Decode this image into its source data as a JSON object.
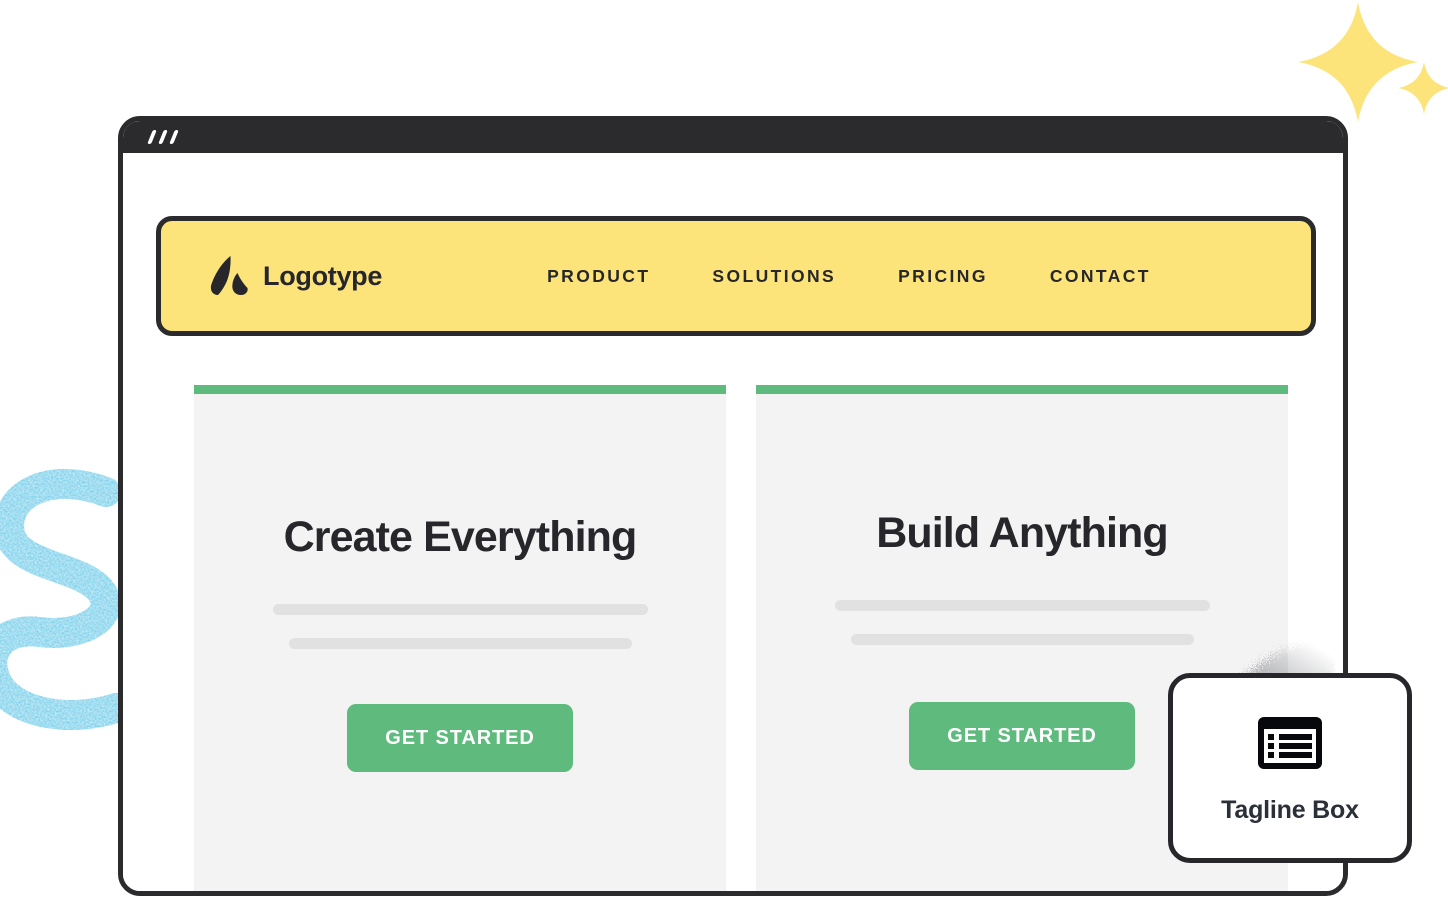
{
  "browser": {
    "window_controls": [
      "dash-1",
      "dash-2",
      "dash-3"
    ]
  },
  "navbar": {
    "logo_icon": "logotype-mark-icon",
    "brand": "Logotype",
    "links": [
      {
        "label": "PRODUCT"
      },
      {
        "label": "SOLUTIONS"
      },
      {
        "label": "PRICING"
      },
      {
        "label": "CONTACT"
      }
    ],
    "background_color": "#FCE47A",
    "border_color": "#2B2B2E"
  },
  "cards": [
    {
      "heading": "Create Everything",
      "cta_label": "GET STARTED",
      "accent_color": "#5FBB7D",
      "background_color": "#F3F3F3"
    },
    {
      "heading": "Build Anything",
      "cta_label": "GET STARTED",
      "accent_color": "#5FBB7D",
      "background_color": "#F3F3F3"
    }
  ],
  "tagline_box": {
    "icon": "list-view-icon",
    "label": "Tagline Box",
    "border_color": "#26262B"
  },
  "decorations": {
    "sparkle_color": "#FCE47A",
    "squiggle_color": "#74CDEA",
    "dispersion_color": "#2B2F38",
    "sparkles": [
      "sparkle-large",
      "sparkle-small"
    ],
    "squiggle": "s-curve-squiggle"
  },
  "colors": {
    "dark": "#2B2B2E",
    "yellow": "#FCE47A",
    "green": "#5FBB7D",
    "card_gray": "#F3F3F3",
    "placeholder_gray": "#E1E1E1",
    "blue": "#74CDEA"
  }
}
